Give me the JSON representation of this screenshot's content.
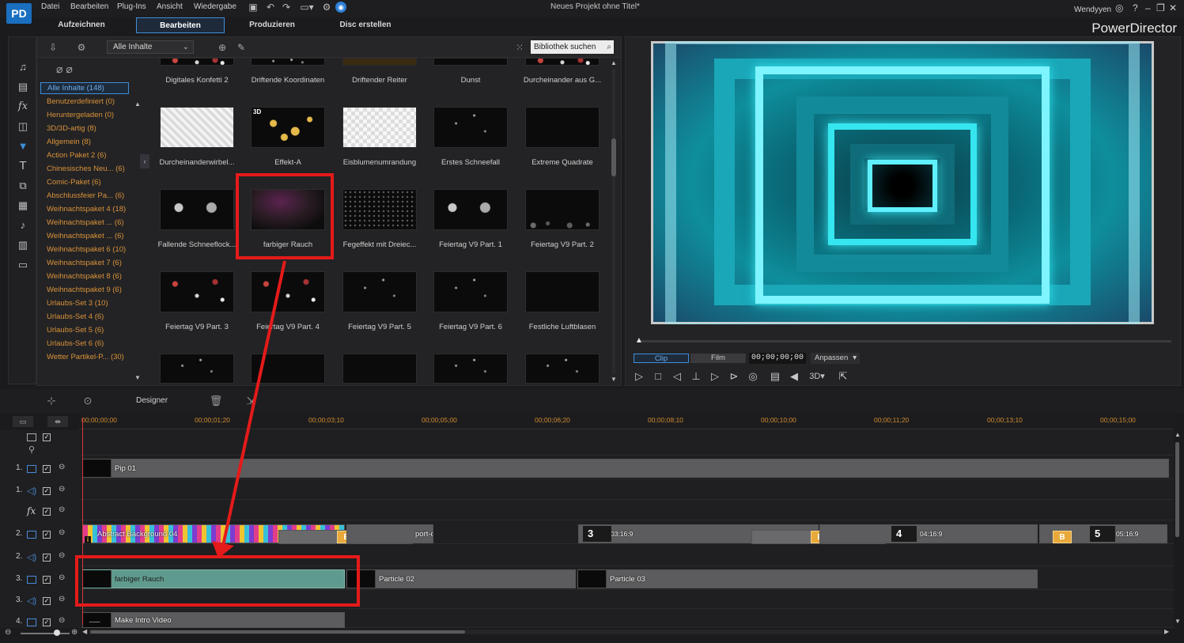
{
  "app": {
    "logo": "PD",
    "menu": [
      "Datei",
      "Bearbeiten",
      "Plug-Ins",
      "Ansicht",
      "Wiedergabe"
    ],
    "window_title": "Neues Projekt ohne Titel*",
    "user": "Wendyyen",
    "brand": "PowerDirector",
    "modes": [
      "Aufzeichnen",
      "Bearbeiten",
      "Produzieren",
      "Disc erstellen"
    ],
    "active_mode": "Bearbeiten"
  },
  "library": {
    "filter_selected": "Alle Inhalte",
    "search_placeholder": "Bibliothek suchen",
    "categories": [
      "Alle Inhalte (148)",
      "Benutzerdefiniert  (0)",
      "Heruntergeladen  (0)",
      "3D/3D-artig  (8)",
      "Allgemein  (8)",
      "Action Paket 2  (6)",
      "Chinesisches Neu...  (6)",
      "Comic-Paket  (6)",
      "Abschlussfeier Pa...  (6)",
      "Weihnachtspaket 4  (18)",
      "Weihnachtspaket ...  (6)",
      "Weihnachtspaket ...  (6)",
      "Weihnachtspaket 6  (10)",
      "Weihnachtspaket 7  (6)",
      "Weihnachtspaket 8  (6)",
      "Weihnachtspaket 9  (6)",
      "Urlaubs-Set 3  (10)",
      "Urlaubs-Set 4  (6)",
      "Urlaubs-Set 5  (6)",
      "Urlaubs-Set 6  (6)",
      "Wetter Partikel-P...  (30)"
    ],
    "items": [
      "Digitales Konfetti 2",
      "Driftende Koordinaten",
      "Driftender Reiter",
      "Dunst",
      "Durcheinander aus G...",
      "Durcheinanderwirbel...",
      "Effekt-A",
      "Eisblumenumrandung",
      "Erstes Schneefall",
      "Extreme Quadrate",
      "Fallende Schneeflock...",
      "farbiger Rauch",
      "Fegeffekt mit Dreiec...",
      "Feiertag V9 Part. 1",
      "Feiertag V9 Part. 2",
      "Feiertag V9 Part. 3",
      "Feiertag V9 Part. 4",
      "Feiertag V9 Part. 5",
      "Feiertag V9 Part. 6",
      "Festliche Luftblasen"
    ],
    "badge_3d": "3D"
  },
  "preview": {
    "clip_tab": "Clip",
    "film_tab": "Film",
    "timecode": "00;00;00;00",
    "fit": "Anpassen",
    "mode_3d": "3D"
  },
  "timeline": {
    "designer": "Designer",
    "ruler": [
      "00;00;00;00",
      "00;00;01;20",
      "00;00;03;10",
      "00;00;05;00",
      "00;00;06;20",
      "00;00;08;10",
      "00;00;10;00",
      "00;00;11;20",
      "00;00;13;10",
      "00;00;15;00"
    ],
    "track_numbers": [
      "1.",
      "1.",
      "2.",
      "2.",
      "3.",
      "3.",
      "4."
    ],
    "clips": {
      "pip": "Pip 01",
      "abstract": "Abstract Background 04",
      "port": "port-c",
      "seg3_num": "3",
      "seg3_time": "03:16:9",
      "seg4_num": "4",
      "seg4_time": "04:16:9",
      "seg5_num": "5",
      "seg5_time": "05:16:9",
      "badge": "B",
      "info": "i",
      "rauch": "farbiger Rauch",
      "particle2": "Particle 02",
      "particle3": "Particle 03",
      "intro": "Make Intro Video",
      "intro_thumb": "___"
    }
  },
  "colors": {
    "accent": "#3e8ed8",
    "category": "#d9923a",
    "annotation": "#e51a1a",
    "preview_cyan": "#35e6f0"
  }
}
